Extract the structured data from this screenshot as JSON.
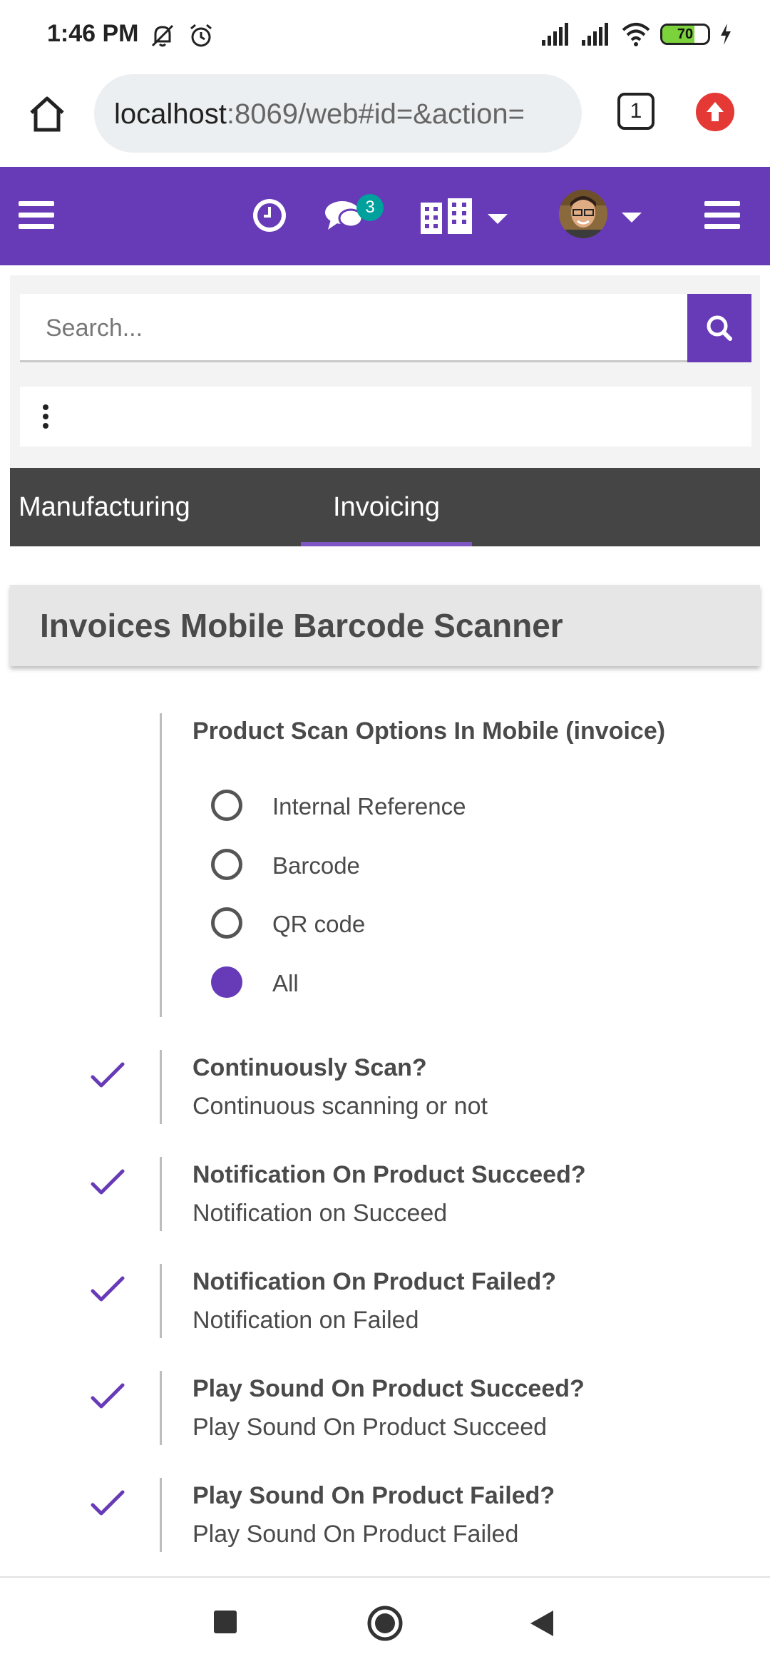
{
  "status": {
    "time": "1:46 PM",
    "battery": "70",
    "battery_level": 0.7
  },
  "browser": {
    "url_host": "localhost",
    "url_rest": ":8069/web#id=&action=",
    "tab_count": "1"
  },
  "header": {
    "messages_badge": "3"
  },
  "search": {
    "placeholder": "Search..."
  },
  "tabs": [
    {
      "label": "Manufacturing"
    },
    {
      "label": "Invoicing"
    }
  ],
  "section": {
    "title": "Invoices Mobile Barcode Scanner"
  },
  "scan_options": {
    "label": "Product Scan Options In Mobile (invoice)",
    "options": [
      {
        "label": "Internal Reference",
        "checked": false
      },
      {
        "label": "Barcode",
        "checked": false
      },
      {
        "label": "QR code",
        "checked": false
      },
      {
        "label": "All",
        "checked": true
      }
    ]
  },
  "settings": [
    {
      "title": "Continuously Scan?",
      "desc": "Continuous scanning or not",
      "checked": true
    },
    {
      "title": "Notification On Product Succeed?",
      "desc": "Notification on Succeed",
      "checked": true
    },
    {
      "title": "Notification On Product Failed?",
      "desc": "Notification on Failed",
      "checked": true
    },
    {
      "title": "Play Sound On Product Succeed?",
      "desc": "Play Sound On Product Succeed",
      "checked": true
    },
    {
      "title": "Play Sound On Product Failed?",
      "desc": "Play Sound On Product Failed",
      "checked": true
    }
  ],
  "colors": {
    "accent": "#673ab7",
    "tab_bar": "#464545",
    "section_bg": "#e6e6e6"
  }
}
